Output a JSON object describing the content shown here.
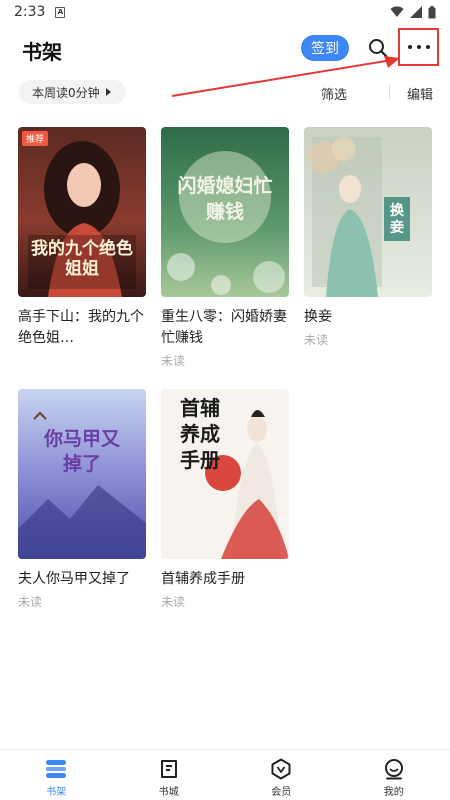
{
  "status_bar": {
    "time": "2:33",
    "sim_letter": "A"
  },
  "header": {
    "title": "书架",
    "checkin_label": "签到"
  },
  "toolbar": {
    "reading_time": "本周读0分钟",
    "filter_label": "筛选",
    "edit_label": "编辑"
  },
  "books": [
    {
      "title": "高手下山：我的九个绝色姐…",
      "status": "",
      "badge": "推荐",
      "cover_text": "我的九个绝色姐姐"
    },
    {
      "title": "重生八零：闪婚娇妻忙赚钱",
      "status": "未读",
      "badge": "",
      "cover_text": "闪婚媳妇忙赚钱"
    },
    {
      "title": "换妾",
      "status": "未读",
      "badge": "",
      "cover_text": "换妾"
    },
    {
      "title": "夫人你马甲又掉了",
      "status": "未读",
      "badge": "",
      "cover_text": "你马甲又掉了"
    },
    {
      "title": "首辅养成手册",
      "status": "未读",
      "badge": "",
      "cover_text": "首辅养成手册"
    }
  ],
  "bottom_nav": [
    {
      "label": "书架",
      "icon": "bookshelf-icon",
      "active": true
    },
    {
      "label": "书城",
      "icon": "bookstore-icon",
      "active": false
    },
    {
      "label": "会员",
      "icon": "vip-icon",
      "active": false
    },
    {
      "label": "我的",
      "icon": "profile-icon",
      "active": false
    }
  ],
  "colors": {
    "accent": "#3d86f5",
    "annotation": "#e53935",
    "badge": "#f0593f"
  }
}
